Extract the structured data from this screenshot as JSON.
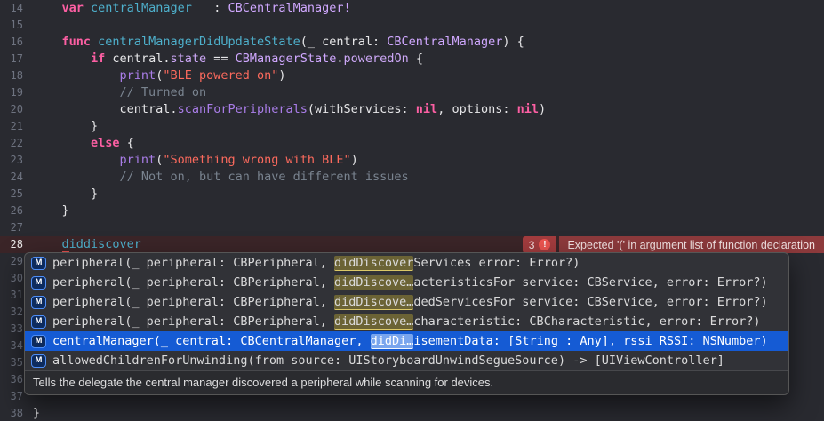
{
  "colors": {
    "editor_bg": "#292a30",
    "keyword": "#fc5fa3",
    "declaration": "#4eb0cc",
    "type_name": "#d0a8ff",
    "function_name": "#a97de8",
    "property": "#cda8f7",
    "string": "#fc6a5d",
    "comment": "#7a8490",
    "error_row_bg": "#3b2528",
    "error_badge_bg": "#a33c3e",
    "error_message_bg": "#8d3a3c",
    "selection_blue": "#155bd4",
    "match_highlight": "#6b6335"
  },
  "editor": {
    "lines": [
      {
        "num": "14",
        "tokens": [
          [
            "plain",
            "    "
          ],
          [
            "keyword",
            "var"
          ],
          [
            "plain",
            " "
          ],
          [
            "decl",
            "centralManager"
          ],
          [
            "plain",
            "   : "
          ],
          [
            "type",
            "CBCentralManager!"
          ]
        ]
      },
      {
        "num": "15",
        "tokens": []
      },
      {
        "num": "16",
        "tokens": [
          [
            "plain",
            "    "
          ],
          [
            "keyword",
            "func"
          ],
          [
            "plain",
            " "
          ],
          [
            "decl",
            "centralManagerDidUpdateState"
          ],
          [
            "plain",
            "(_ central: "
          ],
          [
            "type",
            "CBCentralManager"
          ],
          [
            "plain",
            ") {"
          ]
        ]
      },
      {
        "num": "17",
        "tokens": [
          [
            "plain",
            "        "
          ],
          [
            "keyword",
            "if"
          ],
          [
            "plain",
            " central."
          ],
          [
            "prop",
            "state"
          ],
          [
            "plain",
            " == "
          ],
          [
            "type",
            "CBManagerState"
          ],
          [
            "plain",
            "."
          ],
          [
            "prop",
            "poweredOn"
          ],
          [
            "plain",
            " {"
          ]
        ]
      },
      {
        "num": "18",
        "tokens": [
          [
            "plain",
            "            "
          ],
          [
            "func",
            "print"
          ],
          [
            "plain",
            "("
          ],
          [
            "string",
            "\"BLE powered on\""
          ],
          [
            "plain",
            ")"
          ]
        ]
      },
      {
        "num": "19",
        "tokens": [
          [
            "plain",
            "            "
          ],
          [
            "comment",
            "// Turned on"
          ]
        ]
      },
      {
        "num": "20",
        "tokens": [
          [
            "plain",
            "            central."
          ],
          [
            "func",
            "scanForPeripherals"
          ],
          [
            "plain",
            "(withServices: "
          ],
          [
            "keyword",
            "nil"
          ],
          [
            "plain",
            ", options: "
          ],
          [
            "keyword",
            "nil"
          ],
          [
            "plain",
            ")"
          ]
        ]
      },
      {
        "num": "21",
        "tokens": [
          [
            "plain",
            "        }"
          ]
        ]
      },
      {
        "num": "22",
        "tokens": [
          [
            "plain",
            "        "
          ],
          [
            "keyword",
            "else"
          ],
          [
            "plain",
            " {"
          ]
        ]
      },
      {
        "num": "23",
        "tokens": [
          [
            "plain",
            "            "
          ],
          [
            "func",
            "print"
          ],
          [
            "plain",
            "("
          ],
          [
            "string",
            "\"Something wrong with BLE\""
          ],
          [
            "plain",
            ")"
          ]
        ]
      },
      {
        "num": "24",
        "tokens": [
          [
            "plain",
            "            "
          ],
          [
            "comment",
            "// Not on, but can have different issues"
          ]
        ]
      },
      {
        "num": "25",
        "tokens": [
          [
            "plain",
            "        }"
          ]
        ]
      },
      {
        "num": "26",
        "tokens": [
          [
            "plain",
            "    }"
          ]
        ]
      },
      {
        "num": "27",
        "tokens": []
      },
      {
        "num": "28",
        "error": true,
        "tokens": [
          [
            "plain",
            "    "
          ],
          [
            "decl-err",
            "d"
          ],
          [
            "decl",
            "iddiscover"
          ]
        ]
      },
      {
        "num": "29",
        "tokens": []
      },
      {
        "num": "30",
        "tokens": []
      },
      {
        "num": "31",
        "tokens": []
      },
      {
        "num": "32",
        "tokens": []
      },
      {
        "num": "33",
        "tokens": []
      },
      {
        "num": "34",
        "tokens": []
      },
      {
        "num": "35",
        "tokens": []
      },
      {
        "num": "36",
        "tokens": []
      },
      {
        "num": "37",
        "tokens": []
      },
      {
        "num": "38",
        "tokens": [
          [
            "plain",
            "}"
          ]
        ]
      }
    ]
  },
  "error": {
    "badge_count": "3",
    "badge_icon": "!",
    "message": "Expected '(' in argument list of function declaration"
  },
  "autocomplete": {
    "icon_label": "M",
    "items": [
      {
        "pre": "peripheral(_ peripheral: CBPeripheral, ",
        "match": "didDiscover",
        "post": "Services error: Error?)",
        "selected": false
      },
      {
        "pre": "peripheral(_ peripheral: CBPeripheral, ",
        "match": "didDiscove…",
        "post": "acteristicsFor service: CBService, error: Error?)",
        "selected": false
      },
      {
        "pre": "peripheral(_ peripheral: CBPeripheral, ",
        "match": "didDiscove…",
        "post": "dedServicesFor service: CBService, error: Error?)",
        "selected": false
      },
      {
        "pre": "peripheral(_ peripheral: CBPeripheral, ",
        "match": "didDiscove…",
        "post": "characteristic: CBCharacteristic, error: Error?)",
        "selected": false
      },
      {
        "pre": "centralManager(_ central: CBCentralManager, ",
        "match": "didDi…",
        "post": "isementData: [String : Any], rssi RSSI: NSNumber)",
        "selected": true
      },
      {
        "pre": "allowedChildrenForUnwinding(from source: UIStoryboardUnwindSegueSource) -> [UIViewController]",
        "match": "",
        "post": "",
        "selected": false
      }
    ],
    "description": "Tells the delegate the central manager discovered a peripheral while scanning for devices."
  }
}
